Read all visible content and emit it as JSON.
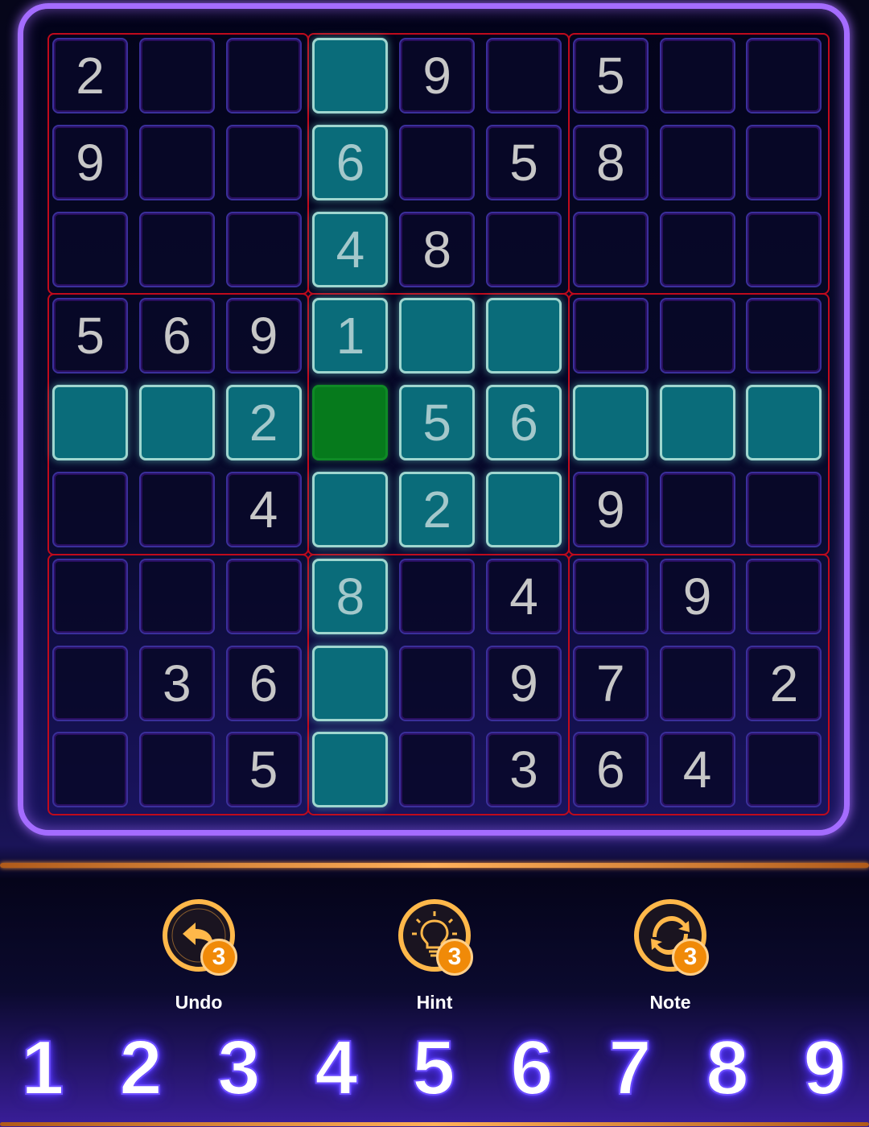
{
  "grid": [
    [
      "2",
      "",
      "",
      "",
      "9",
      "",
      "5",
      "",
      ""
    ],
    [
      "9",
      "",
      "",
      "6",
      "",
      "5",
      "8",
      "",
      ""
    ],
    [
      "",
      "",
      "",
      "4",
      "8",
      "",
      "",
      "",
      ""
    ],
    [
      "5",
      "6",
      "9",
      "1",
      "",
      "",
      "",
      "",
      ""
    ],
    [
      "",
      "",
      "2",
      "",
      "5",
      "6",
      "",
      "",
      ""
    ],
    [
      "",
      "",
      "4",
      "",
      "2",
      "",
      "9",
      "",
      ""
    ],
    [
      "",
      "",
      "",
      "8",
      "",
      "4",
      "",
      "9",
      ""
    ],
    [
      "",
      "3",
      "6",
      "",
      "",
      "9",
      "7",
      "",
      "2"
    ],
    [
      "",
      "",
      "5",
      "",
      "",
      "3",
      "6",
      "4",
      ""
    ]
  ],
  "selected": {
    "row": 4,
    "col": 3
  },
  "colors": {
    "highlight": "#0a6c7a",
    "selected": "#067a1c",
    "box_border": "#c00a1c",
    "frame": "#a46cff",
    "accent": "#f08a08",
    "numpad_glow": "#6b4dff"
  },
  "tools": [
    {
      "name": "undo",
      "label": "Undo",
      "count": "3",
      "icon": "undo-arrow-icon"
    },
    {
      "name": "hint",
      "label": "Hint",
      "count": "3",
      "icon": "lightbulb-icon"
    },
    {
      "name": "note",
      "label": "Note",
      "count": "3",
      "icon": "refresh-icon"
    }
  ],
  "numpad": [
    "1",
    "2",
    "3",
    "4",
    "5",
    "6",
    "7",
    "8",
    "9"
  ]
}
